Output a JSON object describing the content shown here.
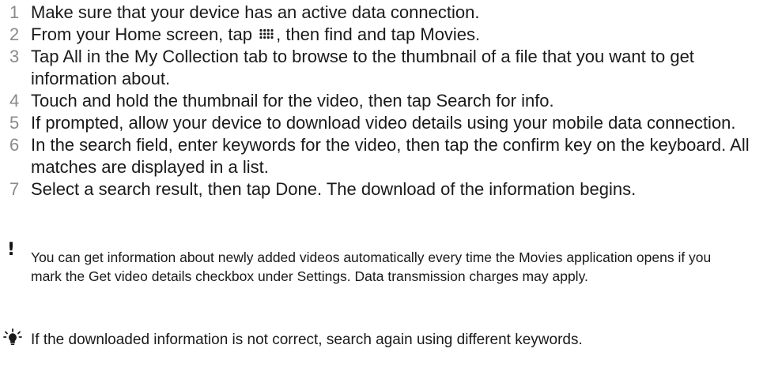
{
  "steps": [
    {
      "num": "1",
      "text": "Make sure that your device has an active data connection."
    },
    {
      "num": "2",
      "text_before": "From your Home screen, tap ",
      "text_after": ", then find and tap Movies."
    },
    {
      "num": "3",
      "text": "Tap All in the My Collection tab to browse to the thumbnail of a file that you want to get information about."
    },
    {
      "num": "4",
      "text": "Touch and hold the thumbnail for the video, then tap Search for info."
    },
    {
      "num": "5",
      "text": "If prompted, allow your device to download video details using your mobile data connection."
    },
    {
      "num": "6",
      "text": "In the search field, enter keywords for the video, then tap the confirm key on the keyboard. All matches are displayed in a list."
    },
    {
      "num": "7",
      "text": "Select a search result, then tap Done. The download of the information begins."
    }
  ],
  "warning": {
    "icon": "exclamation-icon",
    "text": "You can get information about newly added videos automatically every time the Movies application opens if you mark the Get video details checkbox under Settings. Data transmission charges may apply."
  },
  "tip": {
    "icon": "lightbulb-icon",
    "text": "If the downloaded information is not correct, search again using different keywords."
  },
  "inline_icon": "apps-grid-icon"
}
